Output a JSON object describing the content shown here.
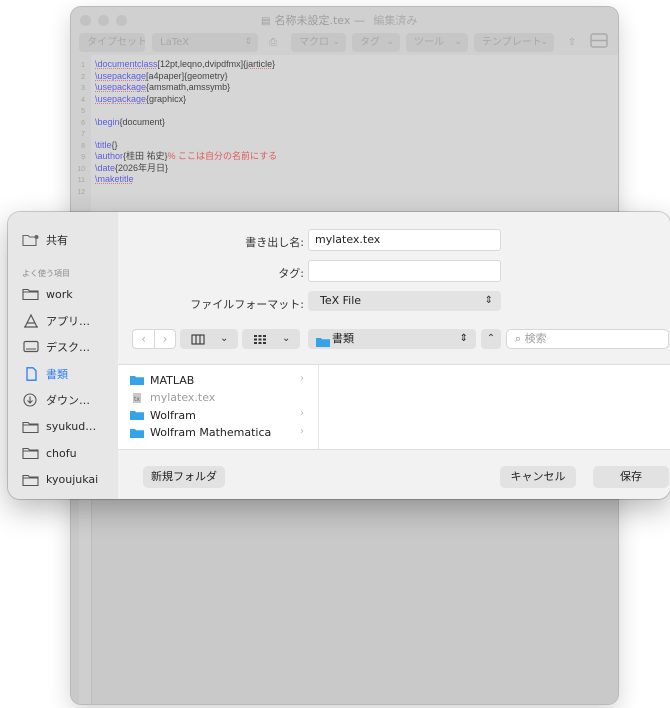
{
  "editor": {
    "title": "名称未設定.tex",
    "title_sep": "—",
    "edited": "編集済み",
    "toolbar": {
      "typeset": "タイプセット",
      "engine": "LaTeX",
      "macro": "マクロ",
      "tags": "タグ",
      "tools": "ツール",
      "template": "テンプレート"
    },
    "lines": [
      {
        "num": "1",
        "parts": [
          {
            "t": "\\documentclass",
            "c": "cmd"
          },
          {
            "t": "[12pt,leqno,dvipdfmx]{",
            "c": "txt"
          },
          {
            "t": "jarticle",
            "c": "txt under"
          },
          {
            "t": "}",
            "c": "txt"
          }
        ]
      },
      {
        "num": "2",
        "parts": [
          {
            "t": "\\usepackage",
            "c": "cmd"
          },
          {
            "t": "[a4paper]{geometry}",
            "c": "txt"
          }
        ]
      },
      {
        "num": "3",
        "parts": [
          {
            "t": "\\usepackage",
            "c": "cmd"
          },
          {
            "t": "{amsmath,amssymb}",
            "c": "txt"
          }
        ]
      },
      {
        "num": "4",
        "parts": [
          {
            "t": "\\usepackage",
            "c": "cmd"
          },
          {
            "t": "{graphicx}",
            "c": "txt"
          }
        ]
      },
      {
        "num": "5",
        "parts": []
      },
      {
        "num": "6",
        "parts": [
          {
            "t": "\\begin",
            "c": "cmd nou"
          },
          {
            "t": "{document}",
            "c": "txt"
          }
        ]
      },
      {
        "num": "7",
        "parts": []
      },
      {
        "num": "8",
        "parts": [
          {
            "t": "\\title",
            "c": "cmd nou"
          },
          {
            "t": "{}",
            "c": "txt"
          }
        ]
      },
      {
        "num": "9",
        "parts": [
          {
            "t": "\\author",
            "c": "cmd nou"
          },
          {
            "t": "{桂田 祐史}",
            "c": "txt"
          },
          {
            "t": "% ここは自分の名前にする",
            "c": "cmt"
          }
        ]
      },
      {
        "num": "10",
        "parts": [
          {
            "t": "\\date",
            "c": "cmd nou"
          },
          {
            "t": "{2026年月日}",
            "c": "txt"
          }
        ]
      },
      {
        "num": "11",
        "parts": [
          {
            "t": "\\maketitle",
            "c": "cmd"
          }
        ]
      },
      {
        "num": "12",
        "parts": []
      }
    ]
  },
  "dialog": {
    "save_as_label": "書き出し名:",
    "save_as_value": "mylatex.tex",
    "tags_label": "タグ:",
    "tags_value": "",
    "format_label": "ファイルフォーマット:",
    "format_value": "TeX File",
    "location": "書類",
    "search_placeholder": "検索",
    "new_folder": "新規フォルダ",
    "cancel": "キャンセル",
    "save": "保存",
    "files": [
      {
        "name": "MATLAB",
        "kind": "folder",
        "chevron": "›"
      },
      {
        "name": "mylatex.tex",
        "kind": "file",
        "chevron": ""
      },
      {
        "name": "Wolfram",
        "kind": "folder",
        "chevron": "›"
      },
      {
        "name": "Wolfram Mathematica",
        "kind": "folder",
        "chevron": "›"
      }
    ]
  },
  "sidebar": {
    "shared": "共有",
    "favorites_header": "よく使う項目",
    "items": [
      {
        "label": "work",
        "icon": "folder-icon"
      },
      {
        "label": "アプリ…",
        "icon": "applications-icon"
      },
      {
        "label": "デスク…",
        "icon": "desktop-icon"
      },
      {
        "label": "書類",
        "icon": "documents-icon"
      },
      {
        "label": "ダウン…",
        "icon": "downloads-icon"
      },
      {
        "label": "syukud…",
        "icon": "folder-icon"
      },
      {
        "label": "chofu",
        "icon": "folder-icon"
      },
      {
        "label": "kyoujukai",
        "icon": "folder-icon"
      }
    ]
  },
  "colors": {
    "accent": "#2c7ef6",
    "folder_blue": "#35a3e8",
    "command_blue": "#5d5ee0",
    "comment_red": "#e05a5a"
  }
}
